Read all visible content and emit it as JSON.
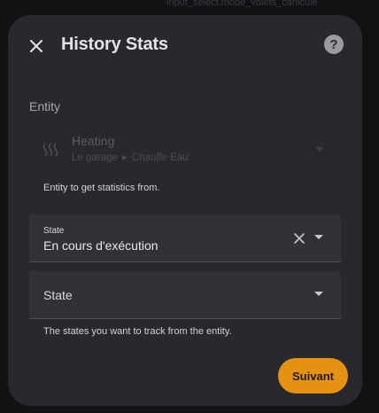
{
  "background": {
    "partial_text": "input_select.mode_volets_canicule"
  },
  "dialog": {
    "title": "History Stats",
    "help_icon": "?",
    "entity_section_label": "Entity",
    "entity": {
      "name": "Heating",
      "area": "Le garage",
      "device": "Chauffe Eau",
      "icon": "radiator-icon",
      "disabled": true
    },
    "entity_helper": "Entity to get statistics from.",
    "state_field_1": {
      "label": "State",
      "value": "En cours d'exécution"
    },
    "state_field_2": {
      "label": "State"
    },
    "states_helper": "The states you want to track from the entity.",
    "submit_label": "Suivant"
  },
  "colors": {
    "dialog_bg": "#28292e",
    "field_bg": "#313237",
    "accent": "#e59212"
  }
}
